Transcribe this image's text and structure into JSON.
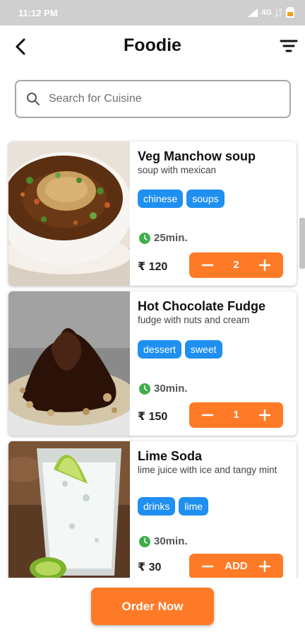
{
  "status_bar": {
    "time": "11:12 PM",
    "network": "4G",
    "icons": [
      "signal-icon",
      "data-arrows-icon",
      "battery-icon"
    ]
  },
  "header": {
    "title": "Foodie",
    "back_icon": "back-arrow-icon",
    "filter_icon": "filter-icon"
  },
  "search": {
    "placeholder": "Search for Cuisine",
    "value": "",
    "icon": "search-icon"
  },
  "items": [
    {
      "name": "Veg Manchow soup",
      "description": "soup with mexican",
      "tags": [
        "chinese",
        "soups"
      ],
      "time": "25min.",
      "price": "₹ 120",
      "quantity": "2"
    },
    {
      "name": "Hot Chocolate Fudge",
      "description": "fudge with nuts and cream",
      "tags": [
        "dessert",
        "sweet"
      ],
      "time": "30min.",
      "price": "₹ 150",
      "quantity": "1"
    },
    {
      "name": "Lime Soda",
      "description": "lime juice with ice and tangy mint",
      "tags": [
        "drinks",
        "lime"
      ],
      "time": "30min.",
      "price": "₹ 30",
      "quantity": "ADD"
    }
  ],
  "order_button": {
    "label": "Order Now"
  },
  "colors": {
    "accent": "#ff7a26",
    "tag": "#1f8ff0",
    "clock": "#3fae4a"
  }
}
